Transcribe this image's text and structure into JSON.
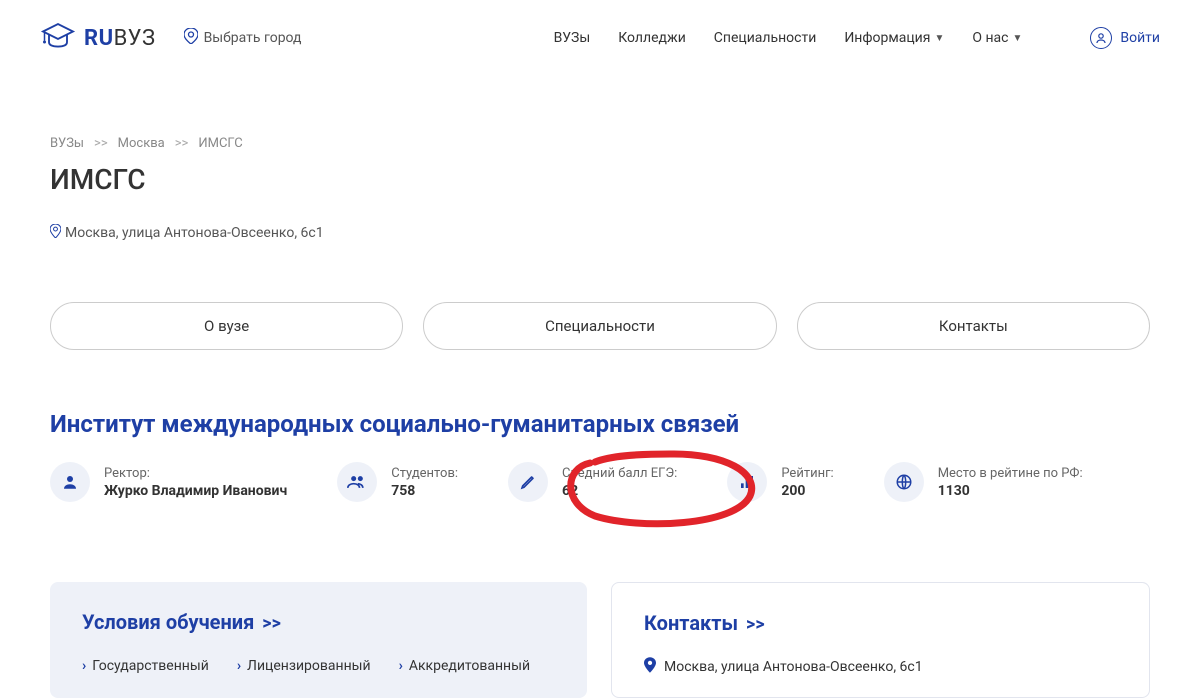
{
  "header": {
    "logo_ru": "RU",
    "logo_vuz": "ВУЗ",
    "city_label": "Выбрать город",
    "nav": {
      "vuzy": "ВУЗы",
      "colleges": "Колледжи",
      "specialties": "Специальности",
      "info": "Информация",
      "about": "О нас"
    },
    "login": "Войти"
  },
  "breadcrumb": {
    "vuzy": "ВУЗы",
    "city": "Москва",
    "current": "ИМСГС"
  },
  "page_title": "ИМСГС",
  "address": "Москва, улица Антонова-Овсеенко, 6с1",
  "tabs": {
    "about": "О вузе",
    "specialties": "Специальности",
    "contacts": "Контакты"
  },
  "section_title": "Институт международных социально-гуманитарных связей",
  "stats": {
    "rector_label": "Ректор:",
    "rector_value": "Журко Владимир Иванович",
    "students_label": "Студентов:",
    "students_value": "758",
    "avg_score_label": "Средний балл ЕГЭ:",
    "avg_score_value": "62",
    "rating_label": "Рейтинг:",
    "rating_value": "200",
    "rank_rf_label": "Место в рейтине по РФ:",
    "rank_rf_value": "1130"
  },
  "conditions": {
    "title": "Условия обучения",
    "arrow": ">>",
    "items": {
      "state": "Государственный",
      "licensed": "Лицензированный",
      "accredited": "Аккредитованный"
    }
  },
  "contacts": {
    "title": "Контакты",
    "arrow": ">>",
    "address": "Москва, улица Антонова-Овсеенко, 6с1"
  }
}
